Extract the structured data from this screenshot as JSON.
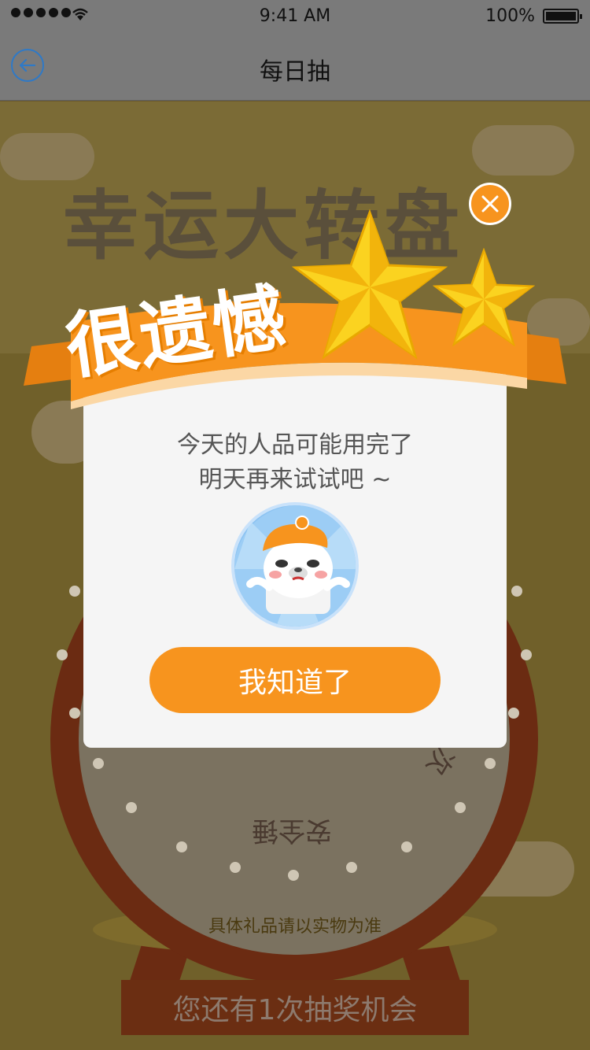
{
  "status_bar": {
    "time": "9:41 AM",
    "battery_percent": "100%",
    "signal_bars": 5
  },
  "nav": {
    "back_icon": "back-arrow-icon",
    "title": "每日抽"
  },
  "scene": {
    "title_ghost": "幸运大转盘",
    "wheel_labels": [
      "安全锤",
      "次"
    ],
    "footnote": "具体礼品请以实物为准",
    "chance_text": "您还有1次抽奖机会"
  },
  "modal": {
    "ribbon_text": "很遗憾",
    "message_line1": "今天的人品可能用完了",
    "message_line2": "明天再来试试吧 ~",
    "confirm_label": "我知道了",
    "close_icon": "close-icon",
    "mascot_icon": "sad-mascot-icon"
  },
  "colors": {
    "accent_orange": "#f7941e",
    "nav_blue": "#2f79c6",
    "modal_bg": "#f5f5f5",
    "wheel_red": "#6b2b12"
  }
}
